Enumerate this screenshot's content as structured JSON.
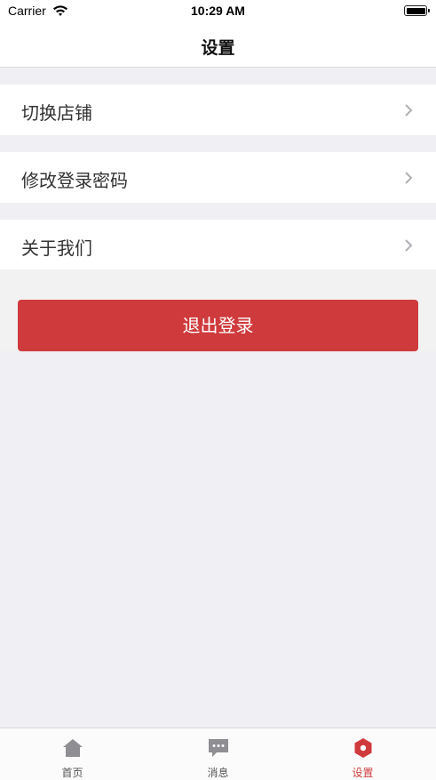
{
  "status_bar": {
    "carrier": "Carrier",
    "time": "10:29 AM"
  },
  "nav": {
    "title": "设置"
  },
  "settings": {
    "items": [
      {
        "label": "切换店铺"
      },
      {
        "label": "修改登录密码"
      },
      {
        "label": "关于我们"
      }
    ]
  },
  "logout": {
    "label": "退出登录"
  },
  "tab_bar": {
    "tabs": [
      {
        "label": "首页",
        "icon": "home-icon"
      },
      {
        "label": "消息",
        "icon": "message-icon"
      },
      {
        "label": "设置",
        "icon": "settings-icon",
        "active": true
      }
    ]
  },
  "colors": {
    "accent": "#cf3a3c",
    "background": "#efeff4",
    "tab_inactive": "#8e8e93"
  }
}
